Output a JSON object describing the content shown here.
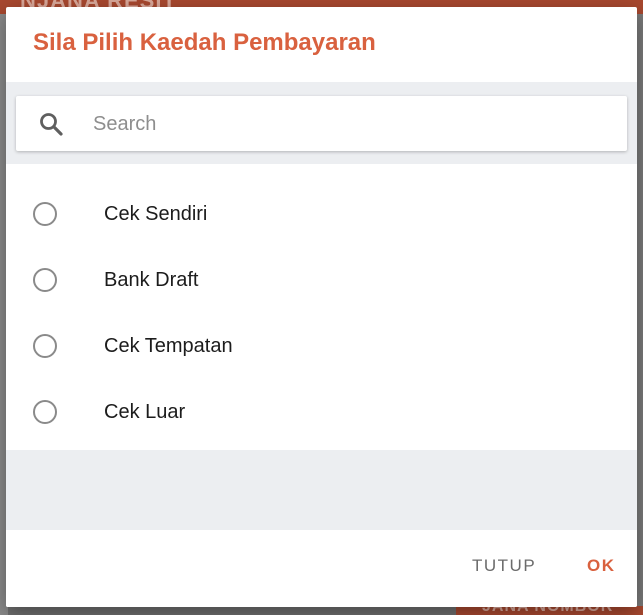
{
  "background": {
    "header_text": "NJANA RESIT",
    "bottom_button_text": "JANA NOMBOR"
  },
  "dialog": {
    "title": "Sila Pilih Kaedah Pembayaran",
    "search": {
      "placeholder": "Search",
      "value": "",
      "icon": "search-icon"
    },
    "options": [
      {
        "label": "Cek Sendiri",
        "selected": false
      },
      {
        "label": "Bank Draft",
        "selected": false
      },
      {
        "label": "Cek Tempatan",
        "selected": false
      },
      {
        "label": "Cek Luar",
        "selected": false
      }
    ],
    "buttons": {
      "cancel_label": "TUTUP",
      "ok_label": "OK"
    }
  },
  "colors": {
    "accent": "#d9613f",
    "band": "#eceef1",
    "radio_border": "#8a8a8a"
  }
}
